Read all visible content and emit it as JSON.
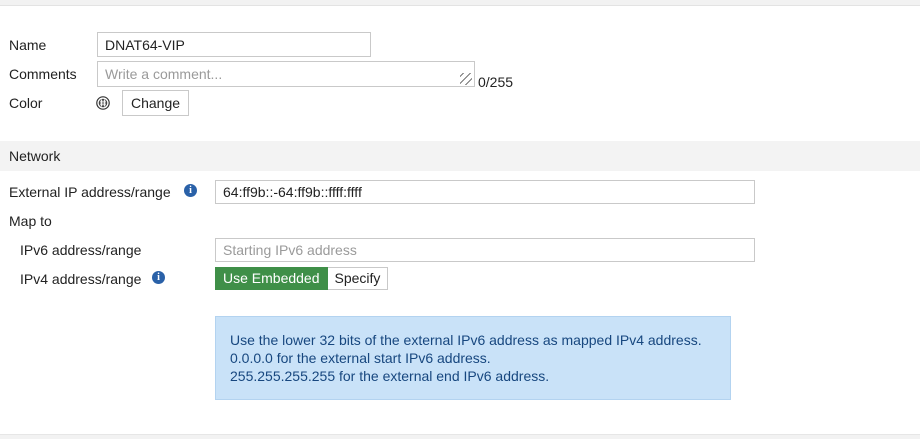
{
  "form": {
    "name_label": "Name",
    "name_value": "DNAT64-VIP",
    "comments_label": "Comments",
    "comments_placeholder": "Write a comment...",
    "comments_counter": "0/255",
    "color_label": "Color",
    "color_change_button": "Change"
  },
  "network": {
    "section_title": "Network",
    "external_ip_label": "External IP address/range",
    "external_ip_value": "64:ff9b::-64:ff9b::ffff:ffff",
    "map_to_label": "Map to",
    "ipv6_label": "IPv6 address/range",
    "ipv6_placeholder": "Starting IPv6 address",
    "ipv4_label": "IPv4 address/range",
    "ipv4_mode_options": [
      "Use Embedded",
      "Specify"
    ],
    "ipv4_mode_selected": "Use Embedded",
    "info_lines": [
      "Use the lower 32 bits of the external IPv6 address as mapped IPv4 address.",
      "0.0.0.0 for the external start IPv6 address.",
      "255.255.255.255 for the external end IPv6 address."
    ]
  },
  "colors": {
    "accent_green": "#3f8f48",
    "info_bg": "#c9e2f8",
    "info_text": "#17477f",
    "info_icon": "#2a61a8"
  }
}
